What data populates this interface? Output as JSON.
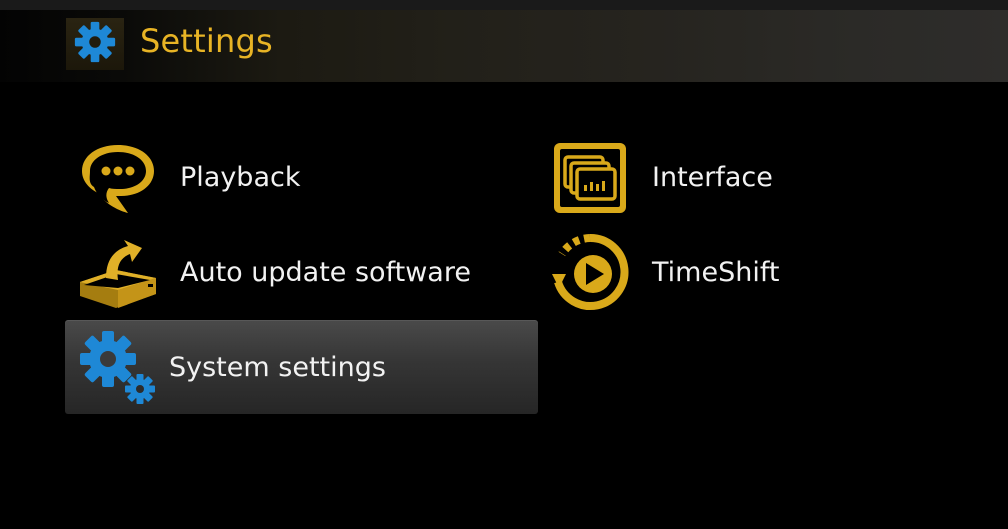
{
  "header": {
    "title": "Settings",
    "icon": "gear-icon"
  },
  "menu": [
    {
      "label": "Playback",
      "icon": "speech-bubble-icon",
      "selected": false
    },
    {
      "label": "Interface",
      "icon": "interface-screens-icon",
      "selected": false
    },
    {
      "label": "Auto update software",
      "icon": "box-download-icon",
      "selected": false
    },
    {
      "label": "TimeShift",
      "icon": "timeshift-play-icon",
      "selected": false
    },
    {
      "label": "System settings",
      "icon": "gears-icon",
      "selected": true
    }
  ],
  "colors": {
    "accent_gold": "#e8b425",
    "icon_gold": "#d9a91a",
    "icon_blue": "#1e88d6",
    "text": "#f2f2f2",
    "background": "#000000",
    "selection": "#353535"
  }
}
